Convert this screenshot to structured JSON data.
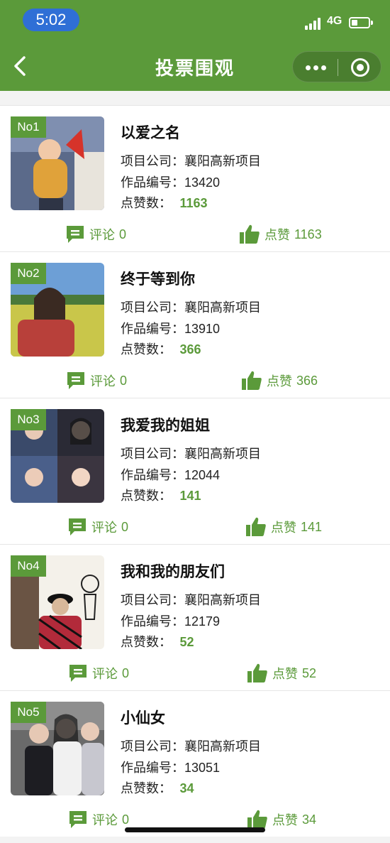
{
  "status_bar": {
    "time": "5:02",
    "network": "4G"
  },
  "nav": {
    "title": "投票围观"
  },
  "labels": {
    "company_prefix": "项目公司：",
    "code_prefix": "作品编号：",
    "likes_prefix": "点赞数：",
    "comment_label": "评论",
    "like_label": "点赞"
  },
  "colors": {
    "accent": "#5b9a3a",
    "time_pill": "#2f6fd6"
  },
  "entries": [
    {
      "rank": "No1",
      "title": "以爱之名",
      "company": "襄阳高新项目",
      "code": "13420",
      "likes": "1163",
      "comments": "0"
    },
    {
      "rank": "No2",
      "title": "终于等到你",
      "company": "襄阳高新项目",
      "code": "13910",
      "likes": "366",
      "comments": "0"
    },
    {
      "rank": "No3",
      "title": "我爱我的姐姐",
      "company": "襄阳高新项目",
      "code": "12044",
      "likes": "141",
      "comments": "0"
    },
    {
      "rank": "No4",
      "title": "我和我的朋友们",
      "company": "襄阳高新项目",
      "code": "12179",
      "likes": "52",
      "comments": "0"
    },
    {
      "rank": "No5",
      "title": "小仙女",
      "company": "襄阳高新项目",
      "code": "13051",
      "likes": "34",
      "comments": "0"
    }
  ]
}
